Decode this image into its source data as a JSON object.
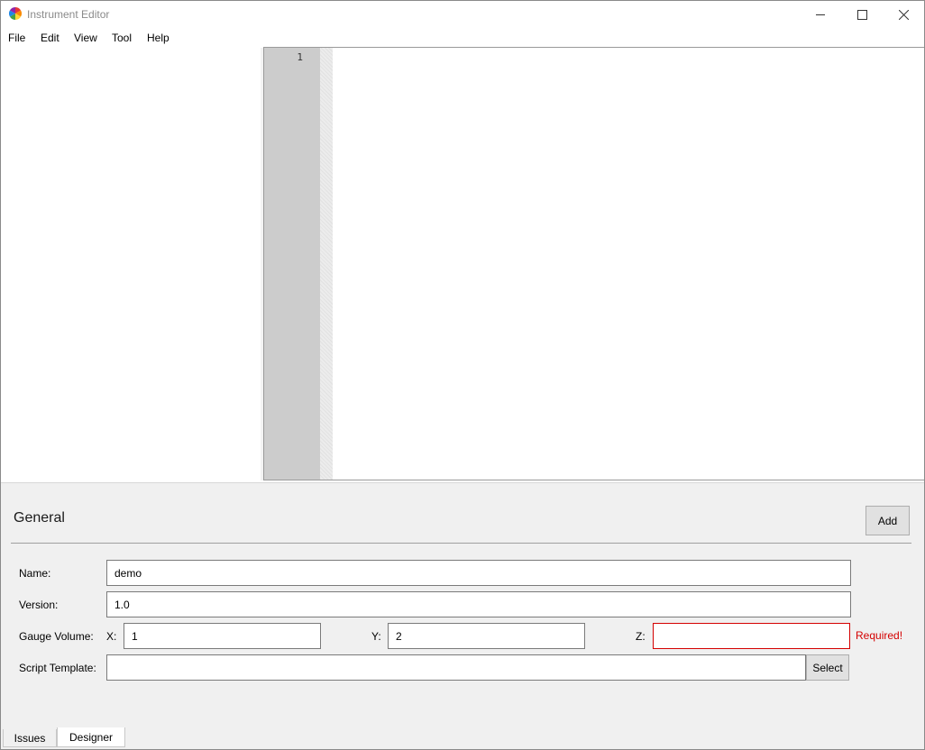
{
  "window": {
    "title": "Instrument Editor"
  },
  "menu": {
    "items": [
      "File",
      "Edit",
      "View",
      "Tool",
      "Help"
    ]
  },
  "editor": {
    "line_numbers": [
      "1"
    ]
  },
  "designer": {
    "section_title": "General",
    "add_label": "Add",
    "fields": {
      "name": {
        "label": "Name:",
        "value": "demo"
      },
      "version": {
        "label": "Version:",
        "value": "1.0"
      },
      "gauge_volume": {
        "label": "Gauge Volume:",
        "x_label": "X:",
        "x_value": "1",
        "y_label": "Y:",
        "y_value": "2",
        "z_label": "Z:",
        "z_value": "",
        "z_error": "Required!"
      },
      "script_template": {
        "label": "Script Template:",
        "value": "",
        "select_label": "Select"
      }
    }
  },
  "tabs": [
    "Issues",
    "Designer"
  ],
  "active_tab": "Designer",
  "colors": {
    "error": "#d40000",
    "gutter": "#cccccc"
  },
  "icons": {
    "app": "color-wheel-icon",
    "minimize": "minimize-icon",
    "maximize": "maximize-icon",
    "close": "close-icon"
  }
}
